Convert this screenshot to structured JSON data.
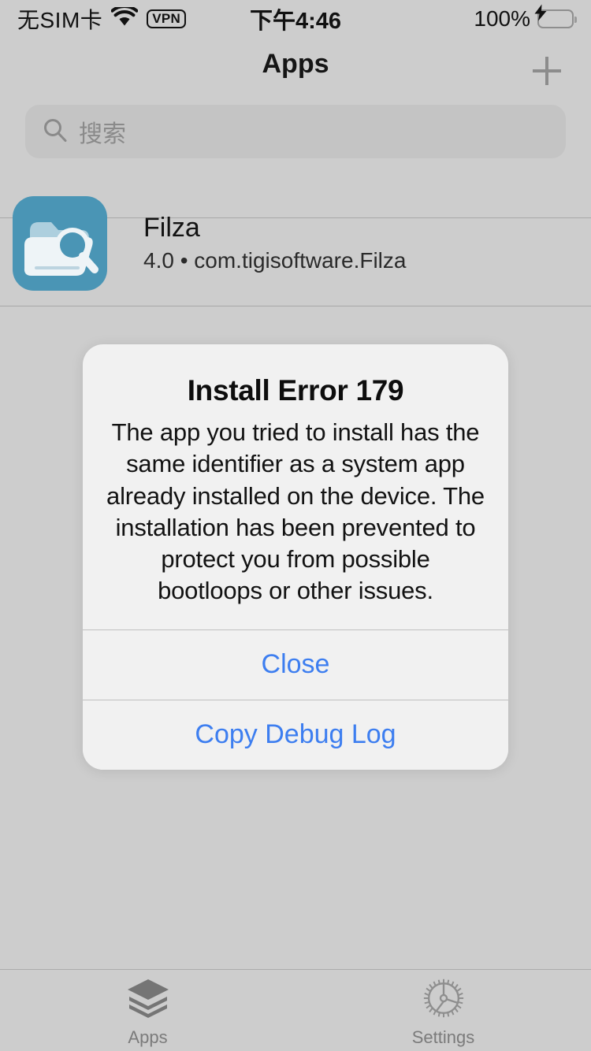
{
  "status_bar": {
    "carrier": "无SIM卡",
    "wifi_icon": "wifi-icon",
    "vpn_badge": "VPN",
    "time": "下午4:46",
    "battery_percent": "100%",
    "battery_state_icon": "battery-charging-icon",
    "battery_color": "#4cd964"
  },
  "nav": {
    "title": "Apps",
    "add_icon": "plus-icon"
  },
  "search": {
    "icon": "search-icon",
    "placeholder": "搜索",
    "value": ""
  },
  "app_list": {
    "rows": [
      {
        "icon": "filza-app-icon",
        "icon_color": "#4a95b5",
        "name": "Filza",
        "subtitle": "4.0 • com.tigisoftware.Filza"
      }
    ]
  },
  "alert": {
    "title": "Install Error 179",
    "message": "The app you tried to install has the same identifier as a system app already installed on the device. The installation has been prevented to protect you from possible bootloops or other issues.",
    "buttons": [
      {
        "label": "Close",
        "name": "close-button"
      },
      {
        "label": "Copy Debug Log",
        "name": "copy-debug-log-button"
      }
    ],
    "accent_color": "#3d7ef0"
  },
  "tab_bar": {
    "tabs": [
      {
        "label": "Apps",
        "icon": "layers-icon",
        "selected": true
      },
      {
        "label": "Settings",
        "icon": "gear-icon",
        "selected": false
      }
    ]
  }
}
